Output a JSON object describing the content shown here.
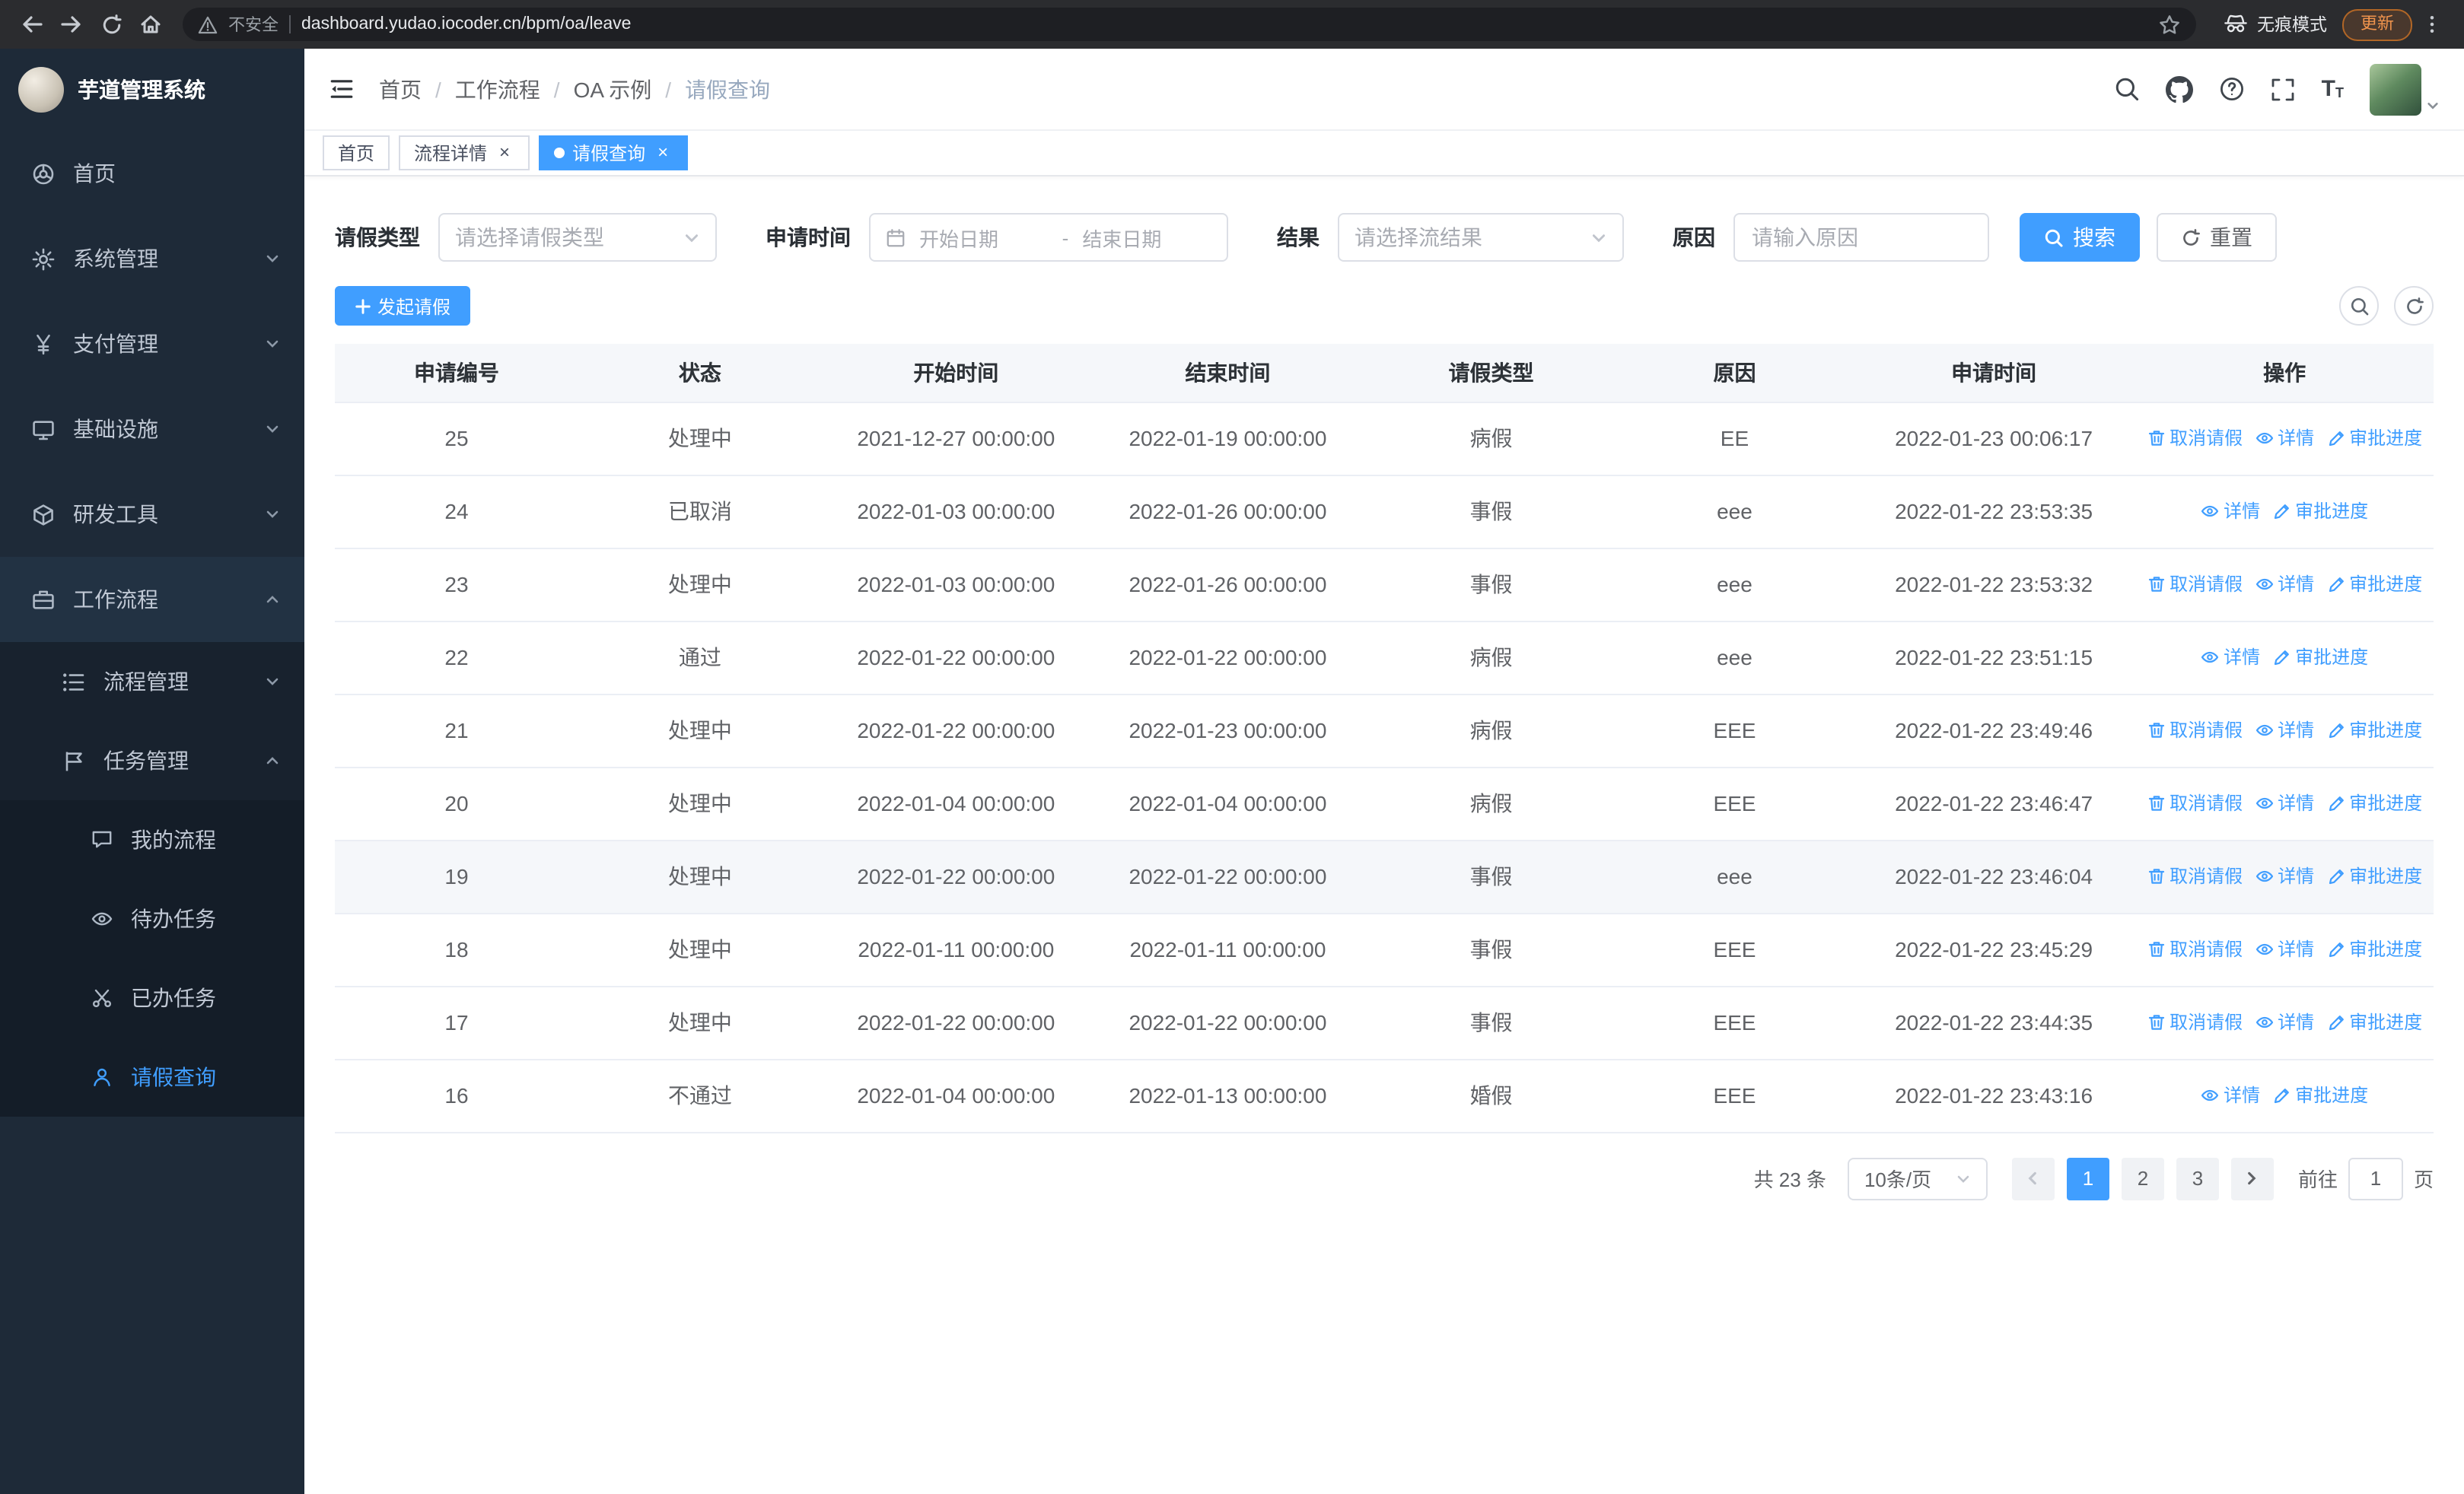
{
  "browser": {
    "security_label": "不安全",
    "url": "dashboard.yudao.iocoder.cn/bpm/oa/leave",
    "incognito_label": "无痕模式",
    "update_label": "更新"
  },
  "sidebar": {
    "app_title": "芋道管理系统",
    "items": [
      {
        "label": "首页"
      },
      {
        "label": "系统管理"
      },
      {
        "label": "支付管理"
      },
      {
        "label": "基础设施"
      },
      {
        "label": "研发工具"
      },
      {
        "label": "工作流程"
      }
    ],
    "workflow_submenu": [
      {
        "label": "流程管理"
      },
      {
        "label": "任务管理"
      }
    ],
    "task_submenu": [
      {
        "label": "我的流程"
      },
      {
        "label": "待办任务"
      },
      {
        "label": "已办任务"
      },
      {
        "label": "请假查询"
      }
    ]
  },
  "header": {
    "breadcrumb": [
      "首页",
      "工作流程",
      "OA 示例",
      "请假查询"
    ],
    "separator": "/"
  },
  "tabs": [
    {
      "label": "首页",
      "closable": false,
      "active": false
    },
    {
      "label": "流程详情",
      "closable": true,
      "active": false
    },
    {
      "label": "请假查询",
      "closable": true,
      "active": true
    }
  ],
  "filters": {
    "leave_type_label": "请假类型",
    "leave_type_placeholder": "请选择请假类型",
    "apply_time_label": "申请时间",
    "start_date_placeholder": "开始日期",
    "range_separator": "-",
    "end_date_placeholder": "结束日期",
    "result_label": "结果",
    "result_placeholder": "请选择流结果",
    "reason_label": "原因",
    "reason_placeholder": "请输入原因",
    "search_button": "搜索",
    "reset_button": "重置"
  },
  "toolbar": {
    "create_button": "发起请假"
  },
  "table": {
    "columns": [
      "申请编号",
      "状态",
      "开始时间",
      "结束时间",
      "请假类型",
      "原因",
      "申请时间",
      "操作"
    ],
    "action_labels": {
      "cancel": "取消请假",
      "detail": "详情",
      "progress": "审批进度"
    },
    "rows": [
      {
        "id": "25",
        "status": "处理中",
        "start": "2021-12-27 00:00:00",
        "end": "2022-01-19 00:00:00",
        "type": "病假",
        "reason": "EE",
        "applied": "2022-01-23 00:06:17",
        "actions": [
          "cancel",
          "detail",
          "progress"
        ],
        "hover": false
      },
      {
        "id": "24",
        "status": "已取消",
        "start": "2022-01-03 00:00:00",
        "end": "2022-01-26 00:00:00",
        "type": "事假",
        "reason": "eee",
        "applied": "2022-01-22 23:53:35",
        "actions": [
          "detail",
          "progress"
        ],
        "hover": false
      },
      {
        "id": "23",
        "status": "处理中",
        "start": "2022-01-03 00:00:00",
        "end": "2022-01-26 00:00:00",
        "type": "事假",
        "reason": "eee",
        "applied": "2022-01-22 23:53:32",
        "actions": [
          "cancel",
          "detail",
          "progress"
        ],
        "hover": false
      },
      {
        "id": "22",
        "status": "通过",
        "start": "2022-01-22 00:00:00",
        "end": "2022-01-22 00:00:00",
        "type": "病假",
        "reason": "eee",
        "applied": "2022-01-22 23:51:15",
        "actions": [
          "detail",
          "progress"
        ],
        "hover": false
      },
      {
        "id": "21",
        "status": "处理中",
        "start": "2022-01-22 00:00:00",
        "end": "2022-01-23 00:00:00",
        "type": "病假",
        "reason": "EEE",
        "applied": "2022-01-22 23:49:46",
        "actions": [
          "cancel",
          "detail",
          "progress"
        ],
        "hover": false
      },
      {
        "id": "20",
        "status": "处理中",
        "start": "2022-01-04 00:00:00",
        "end": "2022-01-04 00:00:00",
        "type": "病假",
        "reason": "EEE",
        "applied": "2022-01-22 23:46:47",
        "actions": [
          "cancel",
          "detail",
          "progress"
        ],
        "hover": false
      },
      {
        "id": "19",
        "status": "处理中",
        "start": "2022-01-22 00:00:00",
        "end": "2022-01-22 00:00:00",
        "type": "事假",
        "reason": "eee",
        "applied": "2022-01-22 23:46:04",
        "actions": [
          "cancel",
          "detail",
          "progress"
        ],
        "hover": true
      },
      {
        "id": "18",
        "status": "处理中",
        "start": "2022-01-11 00:00:00",
        "end": "2022-01-11 00:00:00",
        "type": "事假",
        "reason": "EEE",
        "applied": "2022-01-22 23:45:29",
        "actions": [
          "cancel",
          "detail",
          "progress"
        ],
        "hover": false
      },
      {
        "id": "17",
        "status": "处理中",
        "start": "2022-01-22 00:00:00",
        "end": "2022-01-22 00:00:00",
        "type": "事假",
        "reason": "EEE",
        "applied": "2022-01-22 23:44:35",
        "actions": [
          "cancel",
          "detail",
          "progress"
        ],
        "hover": false
      },
      {
        "id": "16",
        "status": "不通过",
        "start": "2022-01-04 00:00:00",
        "end": "2022-01-13 00:00:00",
        "type": "婚假",
        "reason": "EEE",
        "applied": "2022-01-22 23:43:16",
        "actions": [
          "detail",
          "progress"
        ],
        "hover": false
      }
    ]
  },
  "pagination": {
    "total_text": "共 23 条",
    "page_size": "10条/页",
    "pages": [
      "1",
      "2",
      "3"
    ],
    "active_page": "1",
    "goto_label": "前往",
    "goto_value": "1",
    "goto_suffix": "页"
  },
  "icons": {
    "table_actions": {
      "cancel": "trash-icon",
      "detail": "eye-icon",
      "progress": "edit-icon"
    },
    "accent_color": "#409eff",
    "sidebar_bg": "#1e2a38",
    "active_text_color": "#409eff"
  }
}
